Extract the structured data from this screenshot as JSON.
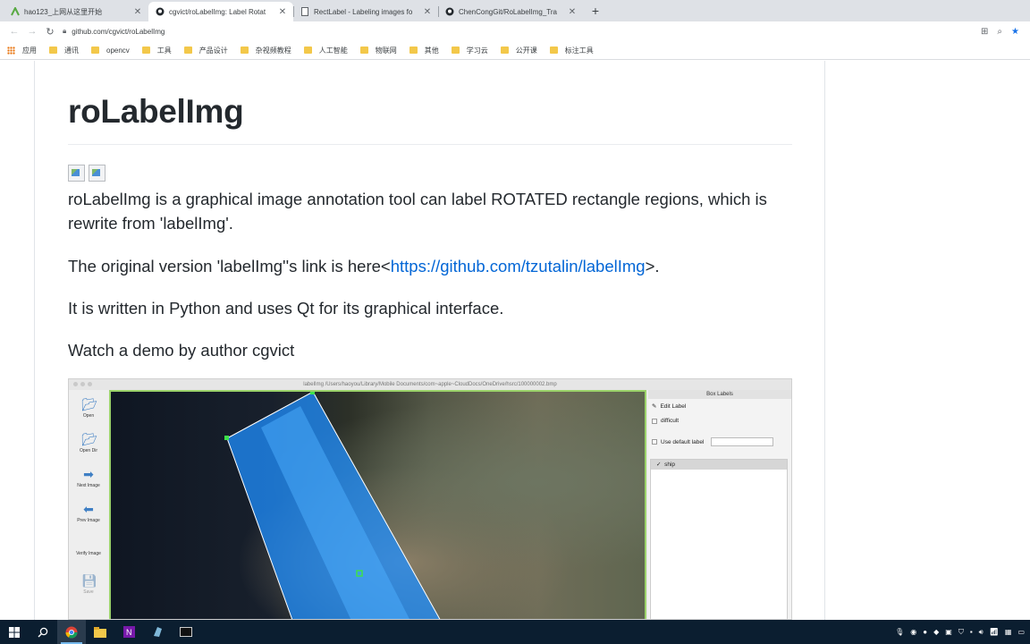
{
  "browser": {
    "tabs": [
      {
        "title": "hao123_上网从这里开始",
        "favicon": "hao123-icon",
        "active": false
      },
      {
        "title": "cgvict/roLabelImg: Label Rotat",
        "favicon": "github-icon",
        "active": true
      },
      {
        "title": "RectLabel - Labeling images fo",
        "favicon": "page-icon",
        "active": false
      },
      {
        "title": "ChenCongGit/RoLabelImg_Tra",
        "favicon": "github-icon",
        "active": false
      }
    ],
    "new_tab": "+",
    "url": "github.com/cgvict/roLabelImg",
    "bookmarks": [
      "应用",
      "通讯",
      "opencv",
      "工具",
      "产品设计",
      "杂视频教程",
      "人工智能",
      "物联网",
      "其他",
      "学习云",
      "公开课",
      "标注工具"
    ]
  },
  "readme": {
    "title": "roLabelImg",
    "p1": "roLabelImg is a graphical image annotation tool can label ROTATED rectangle regions, which is rewrite from 'labelImg'.",
    "p2_prefix": "The original version 'labelImg''s link is here<",
    "p2_link": "https://github.com/tzutalin/labelImg",
    "p2_suffix": ">.",
    "p3": "It is written in Python and uses Qt for its graphical interface.",
    "p4": "Watch a demo by author cgvict"
  },
  "demo": {
    "window_title": "labelImg /Users/haoyou/Library/Mobile Documents/com~apple~CloudDocs/OneDrive/hsrc/100000002.bmp",
    "tools": [
      "Open",
      "Open Dir",
      "Next Image",
      "Prev Image",
      "Verify Image",
      "Save"
    ],
    "panel_title": "Box Labels",
    "edit_label": "Edit Label",
    "difficult": "difficult",
    "use_default_label": "Use default label",
    "labels": [
      "ship"
    ],
    "label_check": "✓"
  },
  "colors": {
    "link": "#0366d6",
    "taskbar": "#0b1e30",
    "box_fill": "#1f8fff",
    "canvas_border": "#9bd26a"
  }
}
